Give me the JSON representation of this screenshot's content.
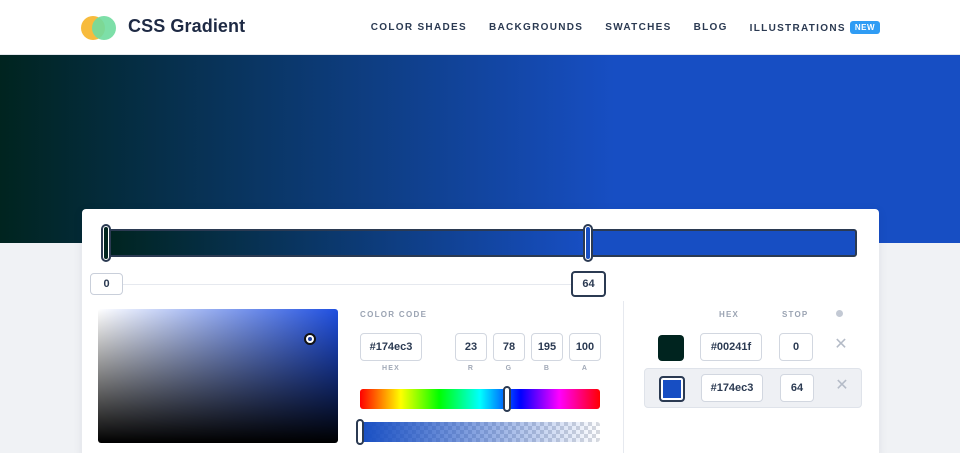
{
  "header": {
    "brand": "CSS Gradient",
    "nav": [
      {
        "label": "COLOR SHADES"
      },
      {
        "label": "BACKGROUNDS"
      },
      {
        "label": "SWATCHES"
      },
      {
        "label": "BLOG"
      },
      {
        "label": "ILLUSTRATIONS",
        "badge": "NEW"
      }
    ]
  },
  "gradient": {
    "stops": [
      {
        "hex": "#00241f",
        "stop": "0"
      },
      {
        "hex": "#174ec3",
        "stop": "64"
      }
    ],
    "active_stop_index": 1
  },
  "picker": {
    "title": "COLOR CODE",
    "hex_value": "#174ec3",
    "r": "23",
    "g": "78",
    "b": "195",
    "a": "100",
    "labels": {
      "hex": "HEX",
      "r": "R",
      "g": "G",
      "b": "B",
      "a": "A"
    }
  },
  "table": {
    "col_hex": "HEX",
    "col_stop": "STOP"
  },
  "icons": {
    "delete": "close-icon",
    "column_dot": "dot-icon",
    "logo": "logo-icon"
  },
  "colors": {
    "accent": "#174ec3",
    "dark": "#00241f",
    "badge": "#2f9cf4"
  }
}
